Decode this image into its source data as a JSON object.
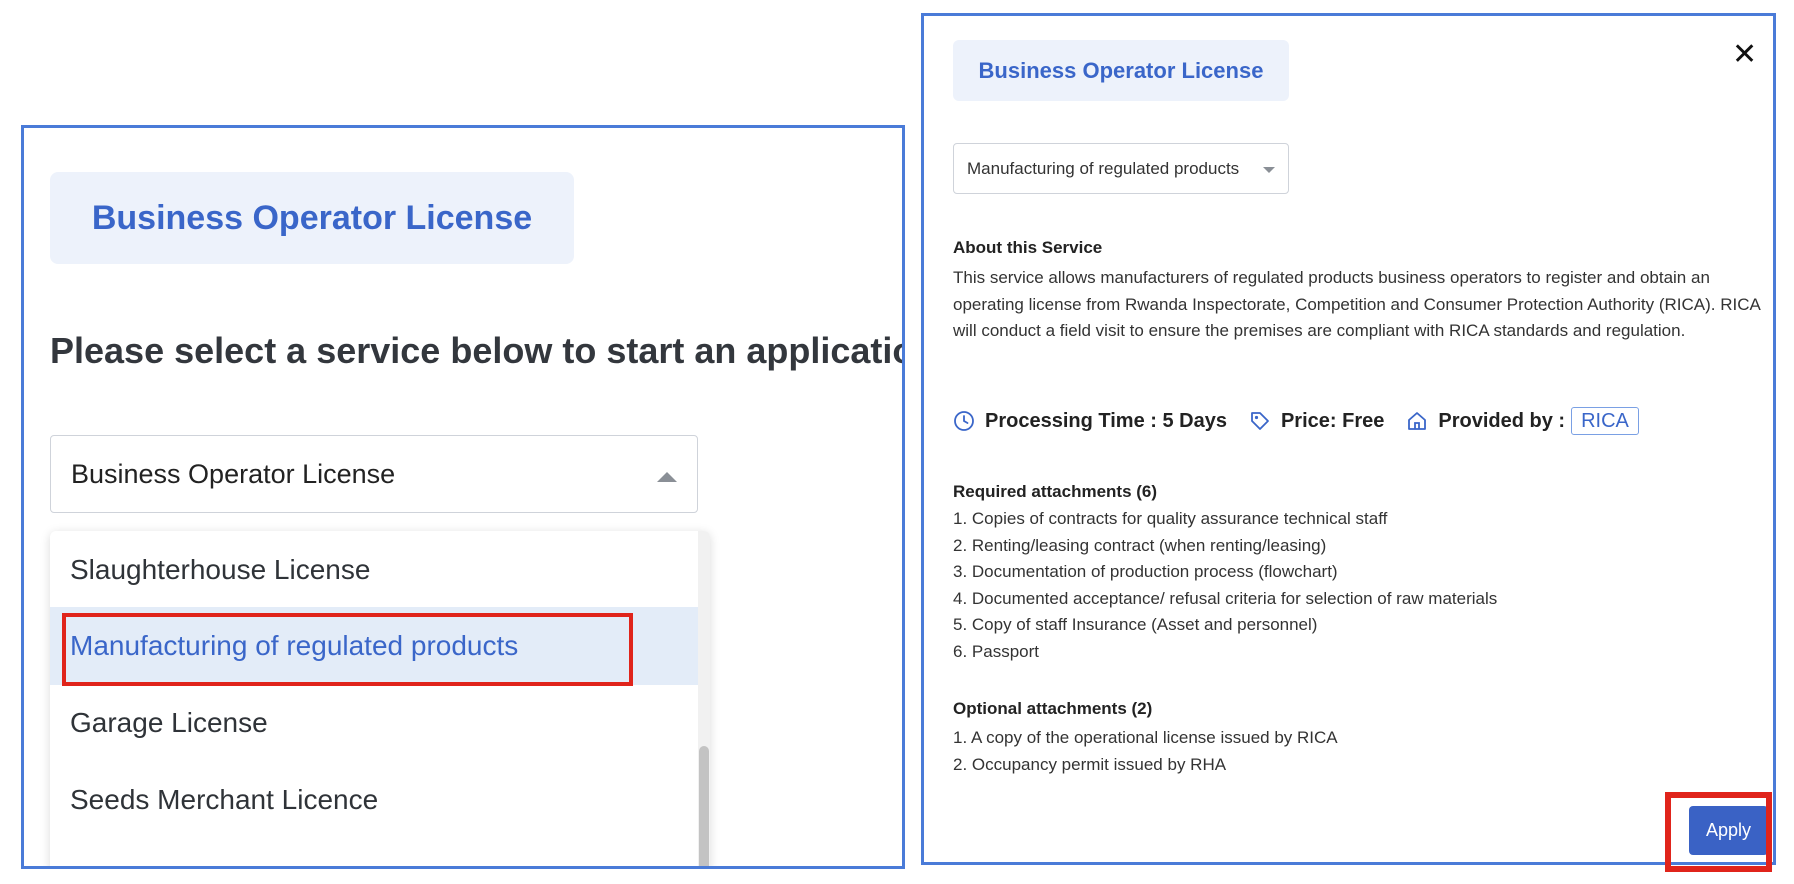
{
  "left": {
    "title": "Business Operator License",
    "heading": "Please select a service below to start an application.",
    "selected_value": "Business Operator License",
    "options": [
      "Slaughterhouse License",
      "Manufacturing of regulated products",
      "Garage License",
      "Seeds Merchant Licence"
    ],
    "highlighted_option": "Manufacturing of regulated products"
  },
  "right": {
    "title": "Business Operator License",
    "selected_service": "Manufacturing of regulated products",
    "close_icon": "close-icon",
    "about_title": "About this Service",
    "about_text": "This service allows manufacturers of regulated products business operators to register and obtain an operating license from Rwanda Inspectorate, Competition and Consumer Protection Authority (RICA). RICA will conduct a field visit to ensure the premises are compliant with RICA standards and regulation.",
    "processing_time": "Processing Time : 5 Days",
    "price": "Price: Free",
    "provided_by_label": "Provided by :",
    "provider": "RICA",
    "required_title": "Required attachments (6)",
    "required": [
      "1. Copies of contracts for quality assurance technical staff",
      "2. Renting/leasing contract (when renting/leasing)",
      "3. Documentation of production process (flowchart)",
      "4. Documented acceptance/ refusal criteria for selection of raw materials",
      "5. Copy of staff Insurance (Asset and personnel)",
      "6. Passport"
    ],
    "optional_title": "Optional attachments (2)",
    "optional": [
      "1. A copy of the operational license issued by RICA",
      "2. Occupancy permit issued by RHA"
    ],
    "apply_label": "Apply"
  },
  "colors": {
    "accent": "#3a66c9",
    "panel_border": "#4a7bd8",
    "highlight": "#e0241b",
    "chip_bg": "#edf2fb"
  }
}
